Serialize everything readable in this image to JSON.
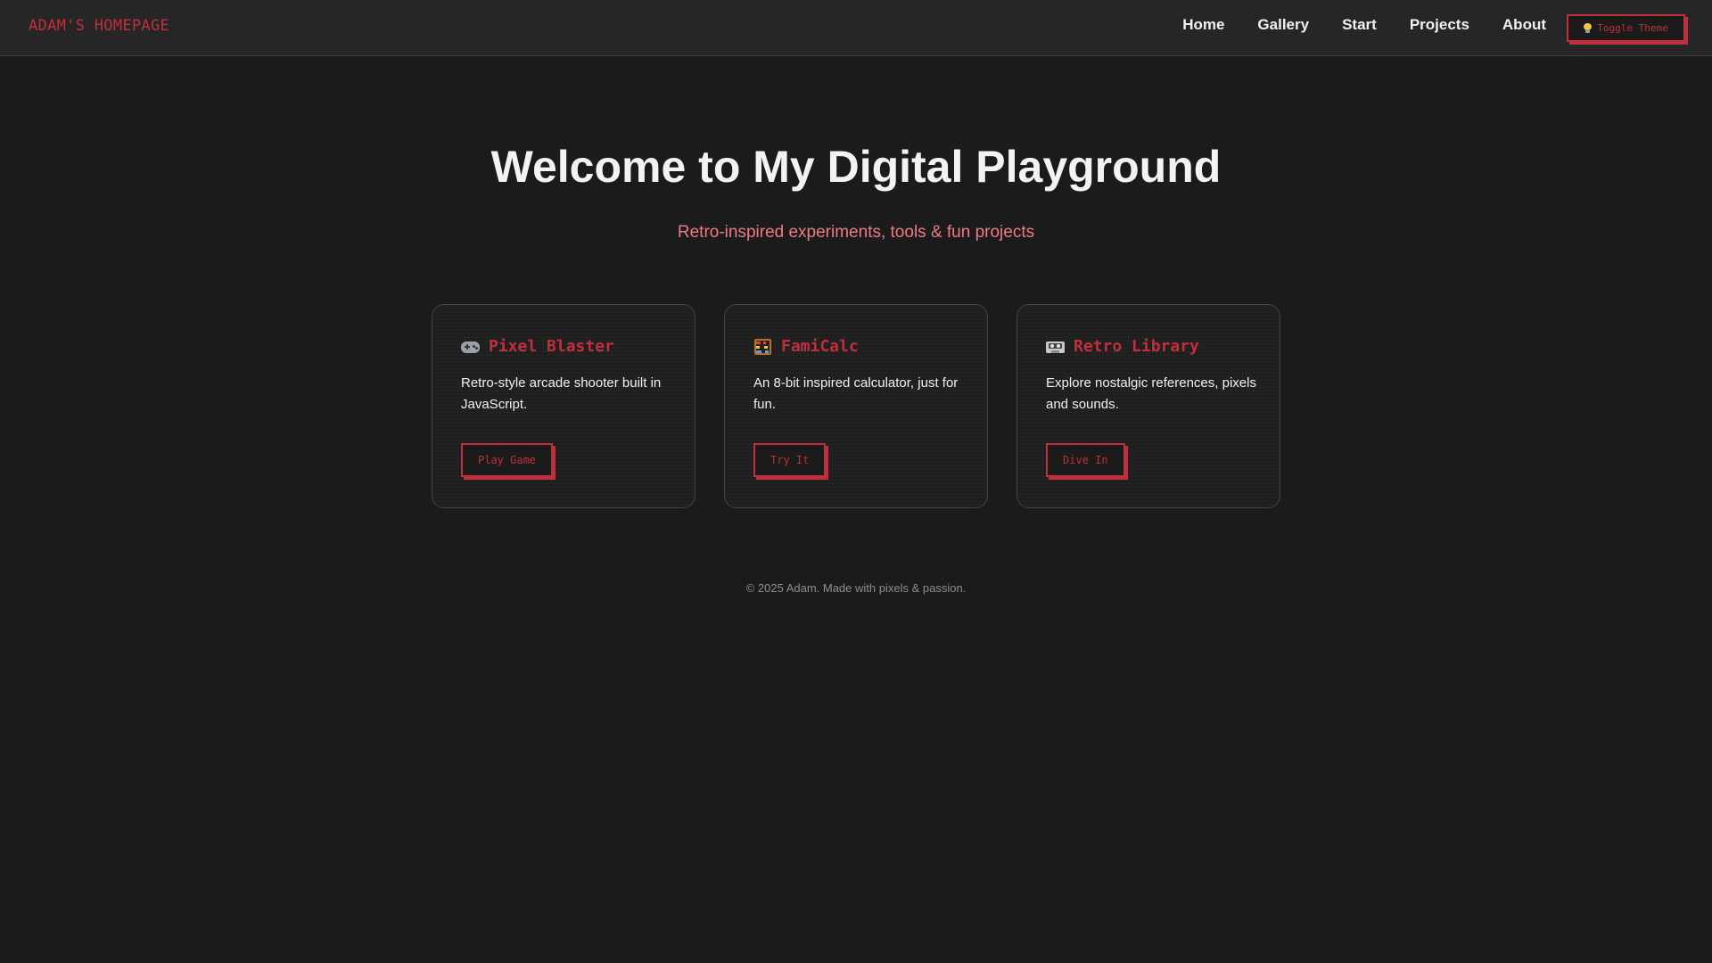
{
  "header": {
    "brand": "ADAM'S HOMEPAGE",
    "nav": [
      {
        "label": "Home"
      },
      {
        "label": "Gallery"
      },
      {
        "label": "Start"
      },
      {
        "label": "Projects"
      },
      {
        "label": "About"
      }
    ],
    "theme_button": {
      "label": "Toggle Theme",
      "icon": "lightbulb-icon"
    }
  },
  "hero": {
    "title": "Welcome to My Digital Playground",
    "subtitle": "Retro-inspired experiments, tools & fun projects"
  },
  "cards": [
    {
      "icon": "gamepad-icon",
      "title": "Pixel Blaster",
      "description": "Retro-style arcade shooter built in JavaScript.",
      "button": "Play Game"
    },
    {
      "icon": "abacus-icon",
      "title": "FamiCalc",
      "description": "An 8-bit inspired calculator, just for fun.",
      "button": "Try It"
    },
    {
      "icon": "cassette-icon",
      "title": "Retro Library",
      "description": "Explore nostalgic references, pixels and sounds.",
      "button": "Dive In"
    }
  ],
  "footer": {
    "text": "© 2025 Adam. Made with pixels & passion."
  },
  "colors": {
    "background": "#1b1b1b",
    "navbar": "#262626",
    "accent": "#c0303c",
    "subtitle": "#ee7b83",
    "text": "#f1f1f1",
    "muted": "#8e8e8e"
  }
}
